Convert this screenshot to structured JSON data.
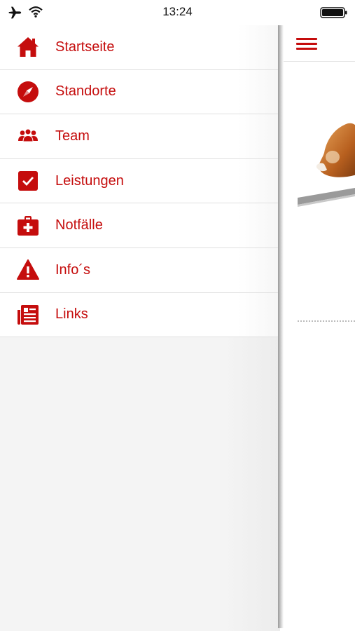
{
  "status_bar": {
    "time": "13:24",
    "icons": [
      "airplane-icon",
      "wifi-icon",
      "battery-icon"
    ]
  },
  "theme": {
    "accent": "#c50d0d",
    "drawer_background": "#f4f4f4",
    "item_background": "#ffffff"
  },
  "menu": {
    "items": [
      {
        "label": "Startseite",
        "icon": "home-icon"
      },
      {
        "label": "Standorte",
        "icon": "compass-icon"
      },
      {
        "label": "Team",
        "icon": "team-icon"
      },
      {
        "label": "Leistungen",
        "icon": "checkbox-icon"
      },
      {
        "label": "Notfälle",
        "icon": "first-aid-kit-icon"
      },
      {
        "label": "Info´s",
        "icon": "warning-icon"
      },
      {
        "label": "Links",
        "icon": "document-list-icon"
      }
    ]
  },
  "main": {
    "menu_button_icon": "hamburger-icon"
  }
}
